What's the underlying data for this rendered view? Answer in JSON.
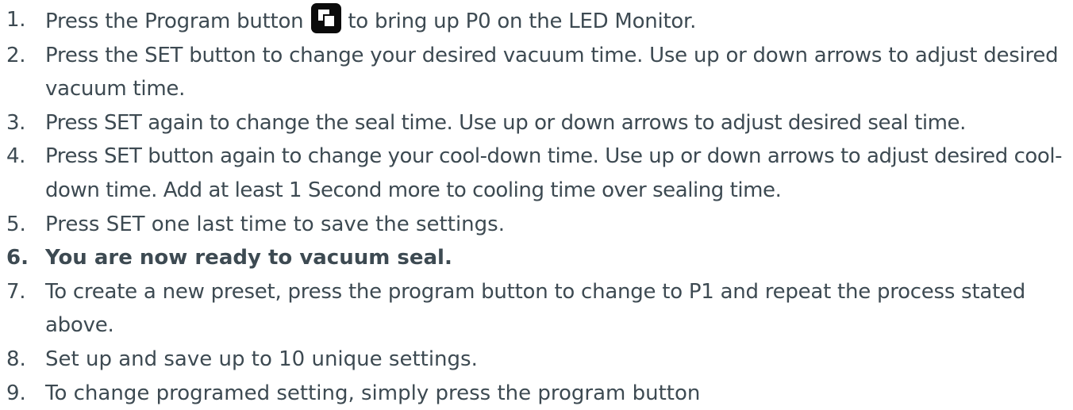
{
  "steps": [
    {
      "num": "1.",
      "before": "Press the Program button",
      "icon": "program-button-icon",
      "after": "to bring up P0 on the LED Monitor."
    },
    {
      "num": "2.",
      "text": "Press the SET button to change your desired vacuum time. Use up or down arrows to adjust desired vacuum time."
    },
    {
      "num": "3.",
      "text": "Press SET again to change the seal time. Use up or down arrows to adjust desired seal time."
    },
    {
      "num": "4.",
      "text": "Press SET button again to change your cool-down time. Use up or down arrows to adjust desired cool-down time. Add at least 1 Second more to cooling time over sealing time."
    },
    {
      "num": "5.",
      "text": "Press SET one last time to save the settings."
    },
    {
      "num": "6.",
      "text": "You are now ready to vacuum seal."
    },
    {
      "num": "7.",
      "text": "To create a new preset, press the program button to change to P1 and repeat the process stated above."
    },
    {
      "num": "8.",
      "text": "Set up and save up to 10 unique settings."
    },
    {
      "num": "9.",
      "text": "To change programed setting, simply press the program button"
    }
  ],
  "colors": {
    "text": "#3d4a52",
    "icon_bg": "#0b0b0b",
    "icon_fg": "#ffffff"
  }
}
